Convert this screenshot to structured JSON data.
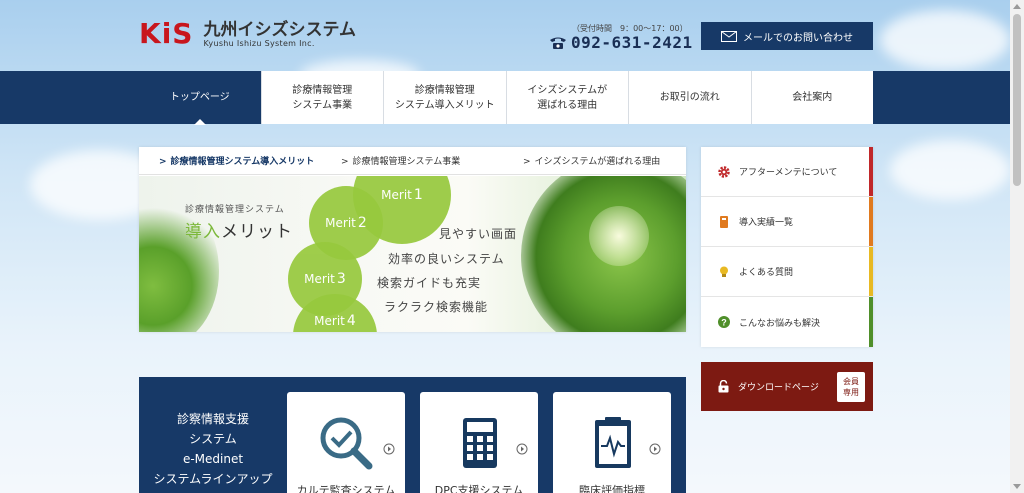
{
  "header": {
    "logo_mark": "KiS",
    "logo_jp": "九州イシズシステム",
    "logo_en": "Kyushu Ishizu System Inc.",
    "hours": "（受付時間　9：00〜17：00）",
    "phone": "092-631-2421",
    "contact_label": "メールでのお問い合わせ"
  },
  "nav": {
    "items": [
      {
        "label": "トップページ"
      },
      {
        "label": "診療情報管理\nシステム事業"
      },
      {
        "label": "診療情報管理\nシステム導入メリット"
      },
      {
        "label": "イシズシステムが\n選ばれる理由"
      },
      {
        "label": "お取引の流れ"
      },
      {
        "label": "会社案内"
      }
    ]
  },
  "slider": {
    "tabs": [
      {
        "label": "診療情報管理システム導入メリット"
      },
      {
        "label": "診療情報管理システム事業"
      },
      {
        "label": "イシズシステムが選ばれる理由"
      }
    ],
    "subtitle": "診療情報管理システム",
    "title_accent": "導入",
    "title_rest": "メリット",
    "merits": [
      {
        "label": "Merit",
        "num": "1"
      },
      {
        "label": "Merit",
        "num": "2"
      },
      {
        "label": "Merit",
        "num": "3"
      },
      {
        "label": "Merit",
        "num": "4"
      }
    ],
    "features": [
      "見やすい画面",
      "効率の良いシステム",
      "検索ガイドも充実",
      "ラクラク検索機能"
    ]
  },
  "side_menu": {
    "items": [
      {
        "label": "アフターメンテについて",
        "icon": "gear-icon",
        "color": "#c0282a"
      },
      {
        "label": "導入実績一覧",
        "icon": "book-icon",
        "color": "#e07a1f"
      },
      {
        "label": "よくある質問",
        "icon": "lightbulb-icon",
        "color": "#e8b923"
      },
      {
        "label": "こんなお悩みも解決",
        "icon": "question-icon",
        "color": "#4f8f2a"
      }
    ],
    "download_label": "ダウンロードページ",
    "member_badge": "会員\n専用"
  },
  "lineup": {
    "title": "診察情報支援\nシステム\ne-Medinet\nシステムラインアップ",
    "cards": [
      {
        "label": "カルテ監査システム",
        "icon": "magnifier-check-icon"
      },
      {
        "label": "DPC支援システム",
        "icon": "calculator-icon"
      },
      {
        "label": "臨床評価指標\nの確立",
        "icon": "clipboard-chart-icon"
      }
    ]
  },
  "colors": {
    "navy": "#173967",
    "brand_red": "#c8161d",
    "download_bg": "#7d1a12",
    "merit_green": "#97c93d"
  }
}
